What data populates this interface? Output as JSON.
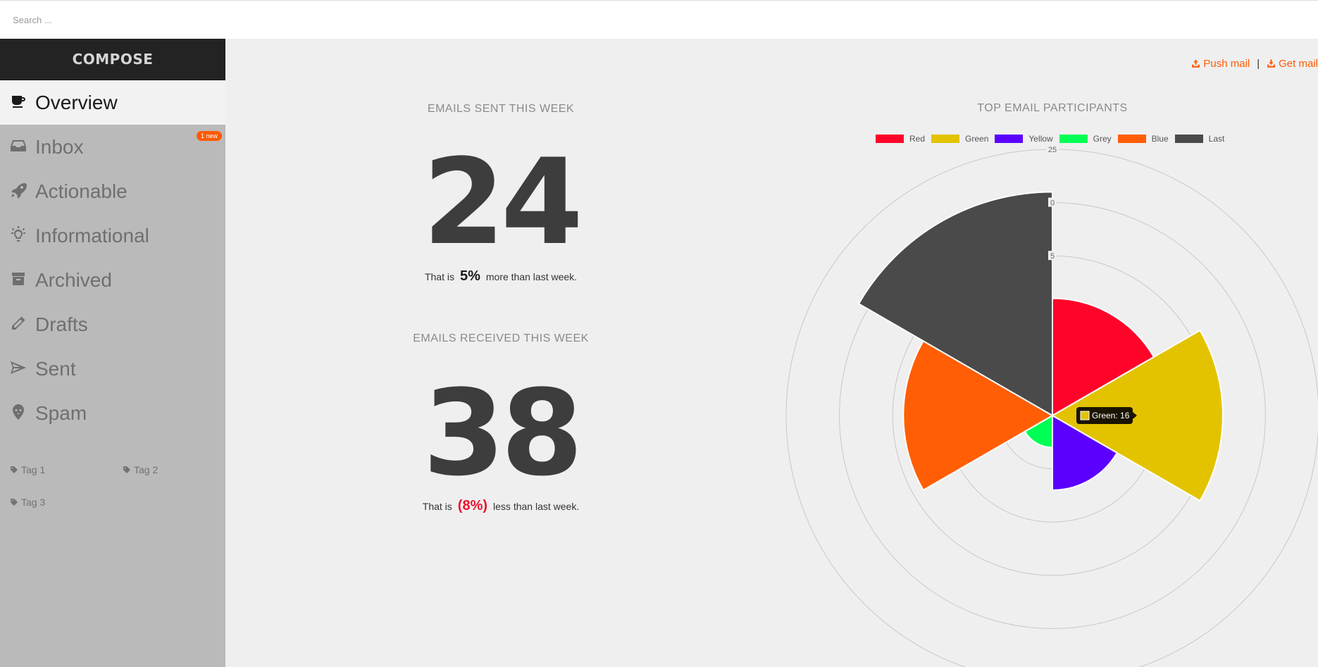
{
  "search": {
    "placeholder": "Search ..."
  },
  "sidebar": {
    "compose_label": "COMPOSE",
    "items": [
      {
        "label": "Overview",
        "icon": "cup-icon",
        "active": true
      },
      {
        "label": "Inbox",
        "icon": "inbox-icon",
        "badge": "1 new"
      },
      {
        "label": "Actionable",
        "icon": "rocket-icon"
      },
      {
        "label": "Informational",
        "icon": "lightbulb-icon"
      },
      {
        "label": "Archived",
        "icon": "archive-icon"
      },
      {
        "label": "Drafts",
        "icon": "pencil-icon"
      },
      {
        "label": "Sent",
        "icon": "paper-plane-icon"
      },
      {
        "label": "Spam",
        "icon": "map-pin-skull-icon"
      }
    ],
    "tags": [
      {
        "label": "Tag 1",
        "icon": "tag-icon"
      },
      {
        "label": "Tag 2",
        "icon": "tag-icon"
      },
      {
        "label": "Tag 3",
        "icon": "tag-icon"
      }
    ]
  },
  "header_actions": {
    "push_label": "Push mail",
    "get_label": "Get mail",
    "separator": "|"
  },
  "sent": {
    "title": "EMAILS SENT THIS WEEK",
    "value": "24",
    "note_prefix": "That is",
    "percent": "5%",
    "note_suffix": "more than last week."
  },
  "received": {
    "title": "EMAILS RECEIVED THIS WEEK",
    "value": "38",
    "note_prefix": "That is",
    "percent": "(8%)",
    "note_suffix": "less than last week."
  },
  "colors": {
    "accent": "#ff5a05",
    "negative": "#e8142e",
    "sidebar_bg": "#bababa",
    "compose_bg": "#232323"
  },
  "chart_data": {
    "type": "polarArea",
    "title": "TOP EMAIL PARTICIPANTS",
    "legend_position": "top",
    "categories": [
      "Red",
      "Green",
      "Yellow",
      "Grey",
      "Blue",
      "Last"
    ],
    "values": [
      11,
      16,
      7,
      3,
      14,
      21
    ],
    "colors": [
      "#ff0429",
      "#e3c300",
      "#5b00ff",
      "#00ff55",
      "#ff5e05",
      "#4a4a4a"
    ],
    "r_ticks": [
      "5",
      "0",
      "25"
    ],
    "r_tick_values": [
      15,
      20,
      25
    ],
    "grid_rings": [
      5,
      10,
      15,
      20,
      25
    ],
    "tooltip": {
      "label": "Green: 16",
      "color": "#e3c300"
    }
  }
}
